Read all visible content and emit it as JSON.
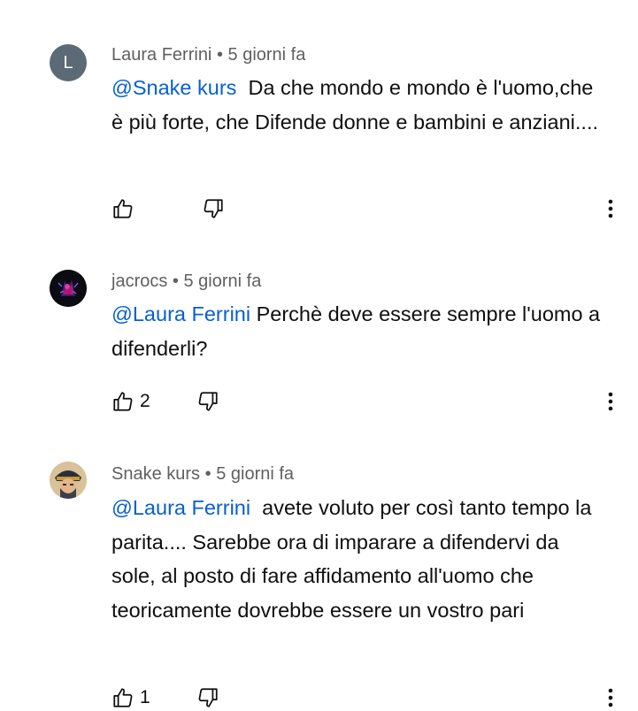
{
  "comments": [
    {
      "author": "Laura Ferrini",
      "time": "5 giorni fa",
      "avatar_letter": "L",
      "mention": "@Snake kurs",
      "text": "Da che mondo e mondo è l'uomo,che è più forte, che Difende donne e bambini e anziani....",
      "likes": ""
    },
    {
      "author": "jacrocs",
      "time": "5 giorni fa",
      "avatar_icon": "anime-avatar-icon",
      "mention": "@Laura Ferrini",
      "text": "Perchè deve essere sempre l'uomo a difenderli?",
      "likes": "2"
    },
    {
      "author": "Snake kurs",
      "time": "5 giorni fa",
      "avatar_icon": "character-avatar-icon",
      "mention": "@Laura Ferrini",
      "text": "avete voluto per così tanto tempo la parita.... Sarebbe ora di imparare a difendervi da sole, al posto di fare affidamento all'uomo che teoricamente dovrebbe essere un vostro pari",
      "likes": "1"
    }
  ],
  "separator": "•",
  "colors": {
    "mention": "#065fd4",
    "meta": "#606060",
    "avatar_letter_bg": "#5b6a75"
  }
}
